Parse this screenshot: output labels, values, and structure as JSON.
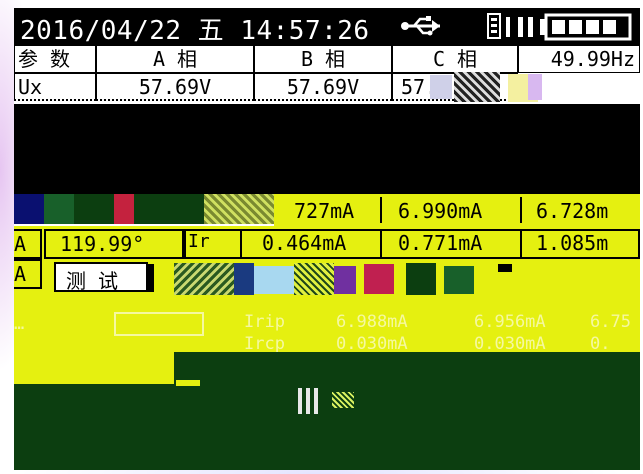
{
  "status_bar": {
    "datetime": "2016/04/22 五 14:57:26",
    "usb_icon": "usb-icon",
    "battery_icon": "battery-icon"
  },
  "header": {
    "param_label": "参 数",
    "phase_a": "A 相",
    "phase_b": "B 相",
    "phase_c": "C 相",
    "frequency": "49.99Hz"
  },
  "ux_row": {
    "label": "Ux",
    "a": "57.69V",
    "b": "57.69V",
    "c": "57.7"
  },
  "current_rows": [
    {
      "label": "",
      "a": "727mA",
      "b": "6.990mA",
      "c": "6.728m"
    },
    {
      "label": "Ir",
      "a": "0.464mA",
      "b": "0.771mA",
      "c": "1.085m"
    }
  ],
  "angle_box": {
    "phase_letter": "A",
    "value": "119.99°"
  },
  "test_button": {
    "label": "测 试"
  },
  "faded_rows": [
    {
      "label": "Irip",
      "a": "6.988mA",
      "b": "6.956mA",
      "c": "6.75"
    },
    {
      "label": "Ircp",
      "a": "0.030mA",
      "b": "0.030mA",
      "c": "0."
    }
  ],
  "colors": {
    "screen_bg": "#ffffff",
    "status_bg": "#000000",
    "glitch_yellow": "#e5f010",
    "glitch_green": "#0c3e10"
  }
}
